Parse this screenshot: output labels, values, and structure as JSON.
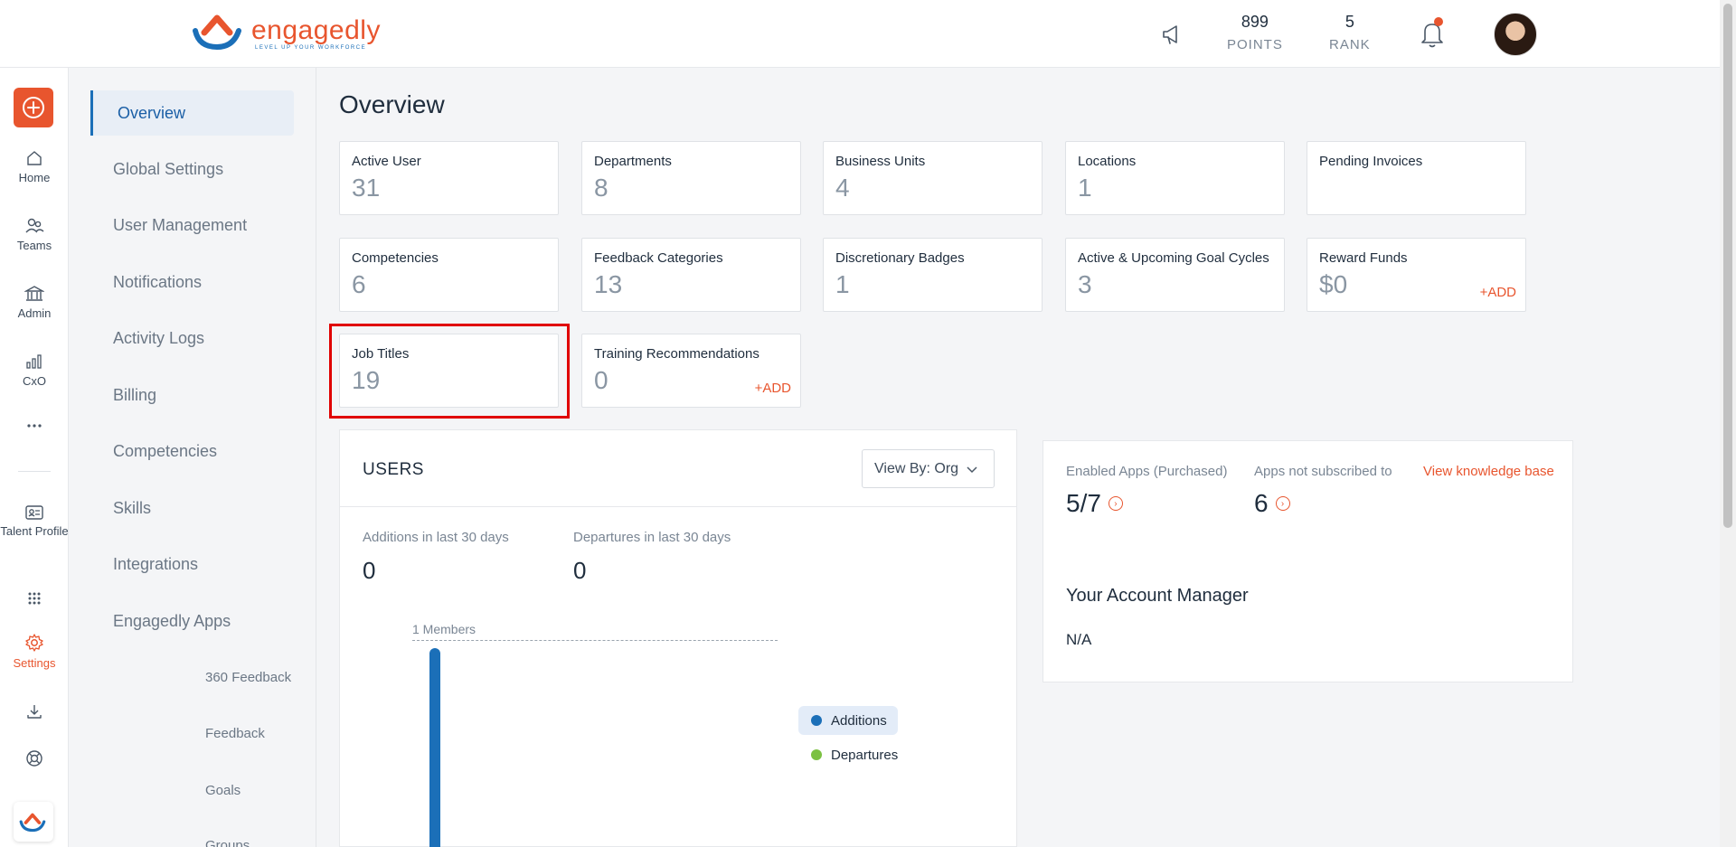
{
  "header": {
    "logo_text": "engagedly",
    "logo_tagline": "LEVEL UP YOUR WORKFORCE",
    "points_value": "899",
    "points_label": "POINTS",
    "rank_value": "5",
    "rank_label": "RANK",
    "icons": [
      "megaphone-icon",
      "bell-icon",
      "avatar"
    ]
  },
  "rail": {
    "items": [
      {
        "label": "Home",
        "icon": "home-icon"
      },
      {
        "label": "Teams",
        "icon": "teams-icon"
      },
      {
        "label": "Admin",
        "icon": "admin-icon"
      },
      {
        "label": "CxO",
        "icon": "bar-chart-icon"
      },
      {
        "label": "",
        "icon": "more-icon"
      },
      {
        "label": "Talent Profile",
        "icon": "id-card-icon"
      },
      {
        "label": "",
        "icon": "apps-grid-icon"
      },
      {
        "label": "Settings",
        "icon": "gear-icon"
      },
      {
        "label": "",
        "icon": "download-icon"
      },
      {
        "label": "",
        "icon": "lifebuoy-icon"
      }
    ]
  },
  "subnav": {
    "items": [
      "Overview",
      "Global Settings",
      "User Management",
      "Notifications",
      "Activity Logs",
      "Billing",
      "Competencies",
      "Skills",
      "Integrations",
      "Engagedly Apps"
    ],
    "sub_items": [
      "360 Feedback",
      "Feedback",
      "Goals",
      "Groups"
    ]
  },
  "main": {
    "title": "Overview",
    "cards": [
      {
        "title": "Active User",
        "value": "31"
      },
      {
        "title": "Departments",
        "value": "8"
      },
      {
        "title": "Business Units",
        "value": "4"
      },
      {
        "title": "Locations",
        "value": "1"
      },
      {
        "title": "Pending Invoices",
        "value": ""
      },
      {
        "title": "Competencies",
        "value": "6"
      },
      {
        "title": "Feedback Categories",
        "value": "13"
      },
      {
        "title": "Discretionary Badges",
        "value": "1"
      },
      {
        "title": "Active & Upcoming Goal Cycles",
        "value": "3"
      },
      {
        "title": "Reward Funds",
        "value": "$0",
        "action": "+ADD"
      },
      {
        "title": "Job Titles",
        "value": "19"
      },
      {
        "title": "Training Recommendations",
        "value": "0",
        "action": "+ADD"
      }
    ]
  },
  "users": {
    "title": "USERS",
    "view_by": "View By: Org",
    "additions_label": "Additions in last 30 days",
    "additions_value": "0",
    "departures_label": "Departures in last 30 days",
    "departures_value": "0",
    "chart_caption": "1 Members",
    "legend": [
      {
        "name": "Additions",
        "color": "#1b6fb8"
      },
      {
        "name": "Departures",
        "color": "#7cc142"
      }
    ]
  },
  "apps": {
    "enabled_label": "Enabled Apps (Purchased)",
    "enabled_value": "5/7",
    "unsub_label": "Apps not subscribed to",
    "unsub_value": "6",
    "kb_link": "View knowledge base",
    "am_title": "Your Account Manager",
    "am_value": "N/A"
  }
}
